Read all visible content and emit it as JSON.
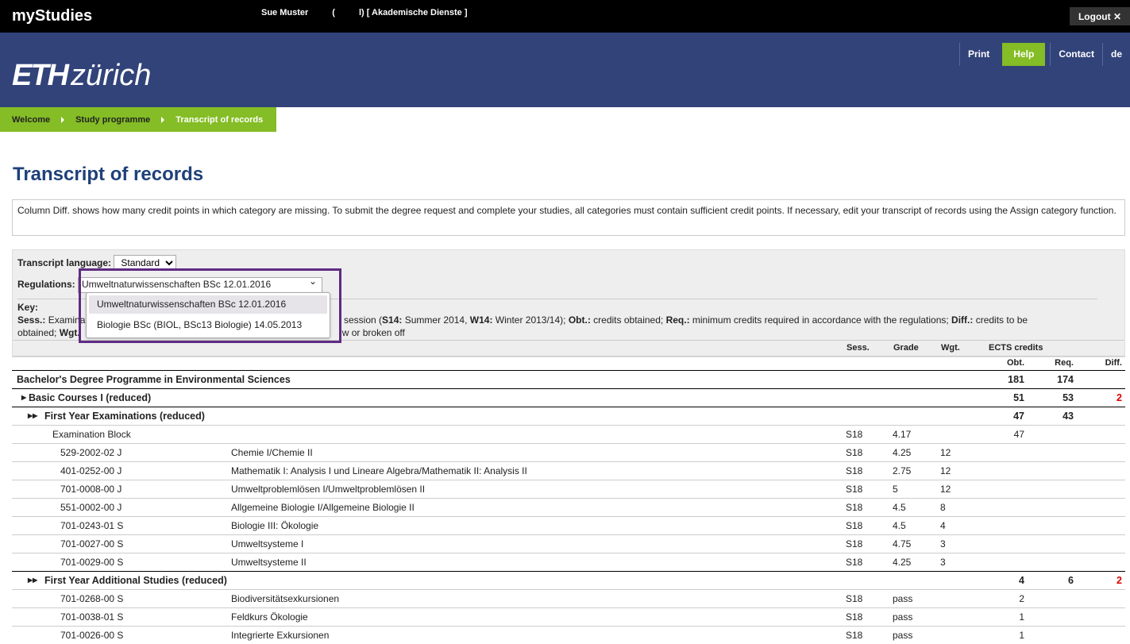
{
  "topbar": {
    "app": "myStudies",
    "user": "Sue Muster",
    "paren": "(",
    "role": "l) [ Akademische Dienste ]",
    "logout": "Logout"
  },
  "banner": {
    "logo_eth": "ETH",
    "logo_zurich": "zürich",
    "nav": [
      "Print",
      "Help",
      "Contact",
      "de"
    ]
  },
  "breadcrumb": [
    "Welcome",
    "Study programme",
    "Transcript of records"
  ],
  "title": "Transcript of records",
  "info": "Column Diff. shows how many credit points in which category are missing. To submit the degree request and complete your studies, all categories must contain sufficient credit points. If necessary, edit your transcript of records using the Assign category function.",
  "form": {
    "language_label": "Transcript language:",
    "language_value": "Standard",
    "regulations_label": "Regulations:",
    "regulations_value": "Umweltnaturwissenschaften BSc 12.01.2016",
    "regulations_options": [
      "Umweltnaturwissenschaften BSc 12.01.2016",
      "Biologie BSc (BIOL, BSc13 Biologie) 14.05.2013"
    ]
  },
  "key": {
    "title": "Key:",
    "line1a": "Sess.:",
    "line1b": " Examina",
    "line1c": "session (",
    "s14": "S14:",
    "s14t": " Summer 2014, ",
    "w14": "W14:",
    "w14t": " Winter 2013/14); ",
    "obt": "Obt.:",
    "obtt": " credits obtained; ",
    "req": "Req.:",
    "reqt": " minimum credits required in accordance with the regulations; ",
    "diff": "Diff.:",
    "difft": " credits to be",
    "line2a": "obtained; ",
    "wgt": "Wgt.",
    "line2b": "w or broken off"
  },
  "headers": {
    "sess": "Sess.",
    "grade": "Grade",
    "wgt": "Wgt.",
    "ects": "ECTS credits",
    "obt": "Obt.",
    "req": "Req.",
    "diff": "Diff."
  },
  "rows": [
    {
      "type": "grp",
      "level": 0,
      "title": "Bachelor's Degree Programme in Environmental Sciences",
      "obt": "181",
      "req": "174",
      "diff": ""
    },
    {
      "type": "grp",
      "level": 1,
      "title": "Basic Courses I (reduced)",
      "obt": "51",
      "req": "53",
      "diff": "2"
    },
    {
      "type": "grp",
      "level": 2,
      "title": "First Year Examinations (reduced)",
      "obt": "47",
      "req": "43",
      "diff": ""
    },
    {
      "type": "block",
      "title": "Examination Block",
      "sess": "S18",
      "grade": "4.17",
      "obt": "47"
    },
    {
      "type": "course",
      "code": "529-2002-02 J",
      "title": "Chemie I/Chemie II",
      "sess": "S18",
      "grade": "4.25",
      "wgt": "12"
    },
    {
      "type": "course",
      "code": "401-0252-00 J",
      "title": "Mathematik I: Analysis I und Lineare Algebra/Mathematik II: Analysis II",
      "sess": "S18",
      "grade": "2.75",
      "wgt": "12"
    },
    {
      "type": "course",
      "code": "701-0008-00 J",
      "title": "Umweltproblemlösen I/Umweltproblemlösen II",
      "sess": "S18",
      "grade": "5",
      "wgt": "12"
    },
    {
      "type": "course",
      "code": "551-0002-00 J",
      "title": "Allgemeine Biologie I/Allgemeine Biologie II",
      "sess": "S18",
      "grade": "4.5",
      "wgt": "8"
    },
    {
      "type": "course",
      "code": "701-0243-01 S",
      "title": "Biologie III: Ökologie",
      "sess": "S18",
      "grade": "4.5",
      "wgt": "4"
    },
    {
      "type": "course",
      "code": "701-0027-00 S",
      "title": "Umweltsysteme I",
      "sess": "S18",
      "grade": "4.75",
      "wgt": "3"
    },
    {
      "type": "course",
      "code": "701-0029-00 S",
      "title": "Umweltsysteme II",
      "sess": "S18",
      "grade": "4.25",
      "wgt": "3"
    },
    {
      "type": "grp",
      "level": 2,
      "title": "First Year Additional Studies (reduced)",
      "obt": "4",
      "req": "6",
      "diff": "2"
    },
    {
      "type": "course",
      "code": "701-0268-00 S",
      "title": "Biodiversitätsexkursionen",
      "sess": "S18",
      "grade": "pass",
      "obt": "2"
    },
    {
      "type": "course",
      "code": "701-0038-01 S",
      "title": "Feldkurs Ökologie",
      "sess": "S18",
      "grade": "pass",
      "obt": "1"
    },
    {
      "type": "course",
      "code": "701-0026-00 S",
      "title": "Integrierte Exkursionen",
      "sess": "S18",
      "grade": "pass",
      "obt": "1"
    }
  ],
  "colors": {
    "banner": "#32437a",
    "accent": "#84bd25",
    "title": "#1f407a",
    "diff": "#dd0000",
    "focus": "#5e2b82"
  }
}
